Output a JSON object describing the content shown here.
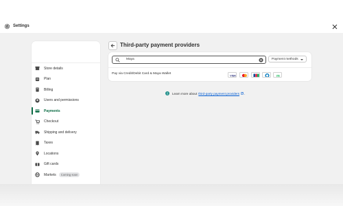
{
  "header": {
    "title": "Settings"
  },
  "sidebar": {
    "items": [
      {
        "label": "Store details",
        "icon": "store-icon"
      },
      {
        "label": "Plan",
        "icon": "plan-icon"
      },
      {
        "label": "Billing",
        "icon": "billing-icon"
      },
      {
        "label": "Users and permissions",
        "icon": "user-icon"
      },
      {
        "label": "Payments",
        "icon": "payments-icon",
        "active": true
      },
      {
        "label": "Checkout",
        "icon": "cart-icon"
      },
      {
        "label": "Shipping and delivery",
        "icon": "truck-icon"
      },
      {
        "label": "Taxes",
        "icon": "receipt-icon"
      },
      {
        "label": "Locations",
        "icon": "location-icon"
      },
      {
        "label": "Gift cards",
        "icon": "gift-card-icon"
      },
      {
        "label": "Markets",
        "icon": "globe-icon",
        "badge": "Coming soon"
      }
    ]
  },
  "main": {
    "title": "Third-party payment providers",
    "search": {
      "value": "Maya"
    },
    "filter_label": "Payment methods",
    "providers": [
      {
        "name": "Pay via Credit/Debit Card & Maya Wallet",
        "methods": [
          "Visa",
          "Mastercard",
          "JCB",
          "Diners",
          "Maya"
        ]
      }
    ],
    "learn_more": {
      "prefix": "Learn more about",
      "link": "third-party payment providers",
      "suffix": "."
    }
  },
  "colors": {
    "accent": "#0b6b44",
    "link": "#005bd3",
    "info": "#1f8f8a"
  }
}
